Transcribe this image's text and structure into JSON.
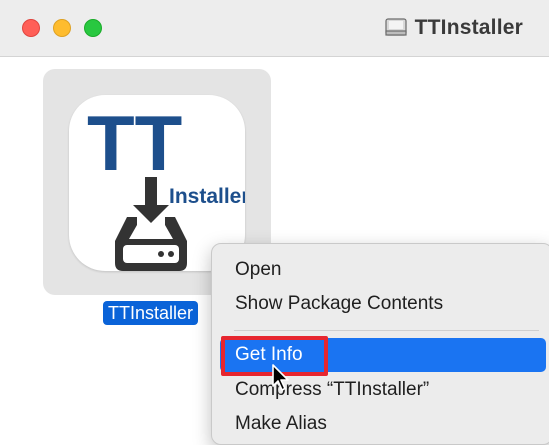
{
  "window": {
    "title": "TTInstaller"
  },
  "file": {
    "name": "TTInstaller",
    "icon": {
      "logo_text": "TT",
      "logo_subtext": "Installer"
    }
  },
  "context_menu": {
    "items": [
      {
        "label": "Open"
      },
      {
        "label": "Show Package Contents"
      },
      {
        "label": "Get Info",
        "selected": true
      },
      {
        "label": "Compress “TTInstaller”"
      },
      {
        "label": "Make Alias"
      }
    ]
  },
  "colors": {
    "close": "#ff5f57",
    "minimize": "#febc2e",
    "maximize": "#28c840",
    "selection": "#1a74f2",
    "label_selection": "#0a63d8",
    "annotation": "#e6262f",
    "logo_blue": "#1d4f8c",
    "logo_dark": "#333333"
  },
  "icons": {
    "traffic_close": "close-dot-icon",
    "traffic_min": "minimize-dot-icon",
    "traffic_max": "maximize-dot-icon",
    "title_icon": "disk-image-icon",
    "cursor": "arrow-cursor-icon"
  }
}
